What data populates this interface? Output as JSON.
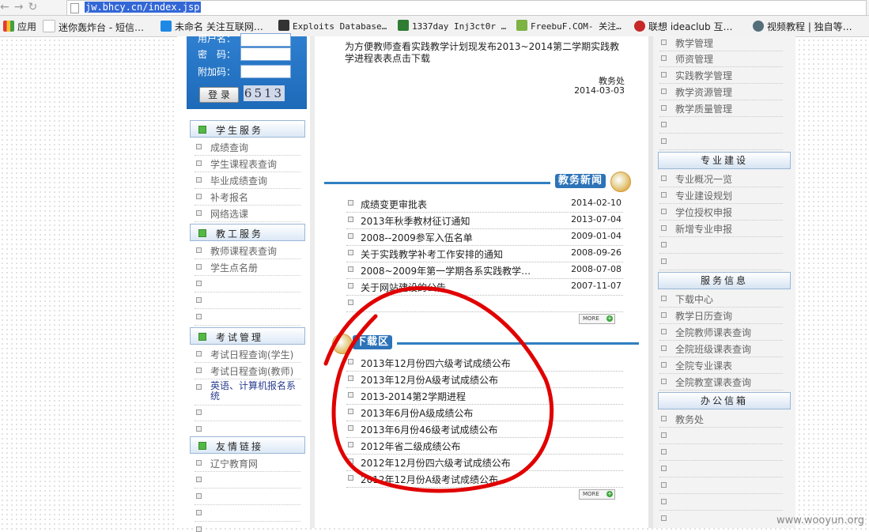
{
  "browser": {
    "url": "jw.bhcy.cn/index.jsp",
    "bookmarks": [
      {
        "label": "应用",
        "color": "#e53935"
      },
      {
        "label": "迷你轰炸台 - 短信…",
        "color": "#ffffff"
      },
      {
        "label": "未命名 关注互联网…",
        "color": "#1e88e5"
      },
      {
        "label": "Exploits Database…",
        "color": "#333333"
      },
      {
        "label": "1337day Inj3ct0r …",
        "color": "#2e7d32"
      },
      {
        "label": "FreebuF.COM- 关注…",
        "color": "#7cb342"
      },
      {
        "label": "联想 ideaclub 互…",
        "color": "#c62828"
      },
      {
        "label": "视频教程 | 独自等…",
        "color": "#546e7a"
      }
    ]
  },
  "login": {
    "username_label": "用户名：",
    "password_label": "密　码：",
    "extra_label": "附加码：",
    "login_button": "登 录",
    "captcha": "6513"
  },
  "left": {
    "student": {
      "title": "学生服务",
      "items": [
        "成绩查询",
        "学生课程表查询",
        "毕业成绩查询",
        "补考报名",
        "网络选课"
      ]
    },
    "staff": {
      "title": "教工服务",
      "items": [
        "教师课程表查询",
        "学生点名册",
        "",
        "",
        ""
      ]
    },
    "exam": {
      "title": "考试管理",
      "items": [
        "考试日程查询(学生)",
        "考试日程查询(教师)",
        "英语、计算机报名系统",
        "",
        ""
      ]
    },
    "links": {
      "title": "友情链接",
      "items": [
        "辽宁教育网",
        "",
        "",
        "",
        ""
      ]
    }
  },
  "notice": {
    "text": "为方便教师查看实践教学计划现发布2013~2014第二学期实践教学进程表表点击下载",
    "link_text": "表点击下载",
    "signer": "教务处",
    "date": "2014-03-03"
  },
  "news": {
    "title": "教务新闻",
    "items": [
      {
        "title": "成绩变更审批表",
        "date": "2014-02-10"
      },
      {
        "title": "2013年秋季教材征订通知",
        "date": "2013-07-04"
      },
      {
        "title": "2008--2009参军入伍名单",
        "date": "2009-01-04"
      },
      {
        "title": "关于实践教学补考工作安排的通知",
        "date": "2008-09-26"
      },
      {
        "title": "2008~2009年第一学期各系实践教学…",
        "date": "2008-07-08"
      },
      {
        "title": "关于网站建设的公告",
        "date": "2007-11-07"
      },
      {
        "title": "",
        "date": ""
      }
    ],
    "more": "MORE"
  },
  "downloads": {
    "title": "下载区",
    "items": [
      "2013年12月份四六级考试成绩公布",
      "2013年12月份A级考试成绩公布",
      "2013-2014第2学期进程",
      "2013年6月份A级成绩公布",
      "2013年6月份46级考试成绩公布",
      "2012年省二级成绩公布",
      "2012年12月份四六级考试成绩公布",
      "2012年12月份A级考试成绩公布"
    ],
    "more": "MORE"
  },
  "right": {
    "teaching": {
      "items": [
        "教学管理",
        "师资管理",
        "实践教学管理",
        "教学资源管理",
        "教学质量管理",
        "",
        ""
      ]
    },
    "major": {
      "title": "专业建设",
      "items": [
        "专业概况一览",
        "专业建设规划",
        "学位授权申报",
        "新增专业申报",
        "",
        ""
      ]
    },
    "service": {
      "title": "服务信息",
      "items": [
        "下载中心",
        "教学日历查询",
        "全院教师课表查询",
        "全院班级课表查询",
        "全院专业课表",
        "全院教室课表查询"
      ]
    },
    "office": {
      "title": "办公信箱",
      "items": [
        "教务处",
        "",
        "",
        "",
        "",
        "",
        "",
        ""
      ]
    }
  },
  "watermark": "www.wooyun.org",
  "colors": {
    "annotation": "#e00000",
    "accent": "#2f7fc0"
  }
}
